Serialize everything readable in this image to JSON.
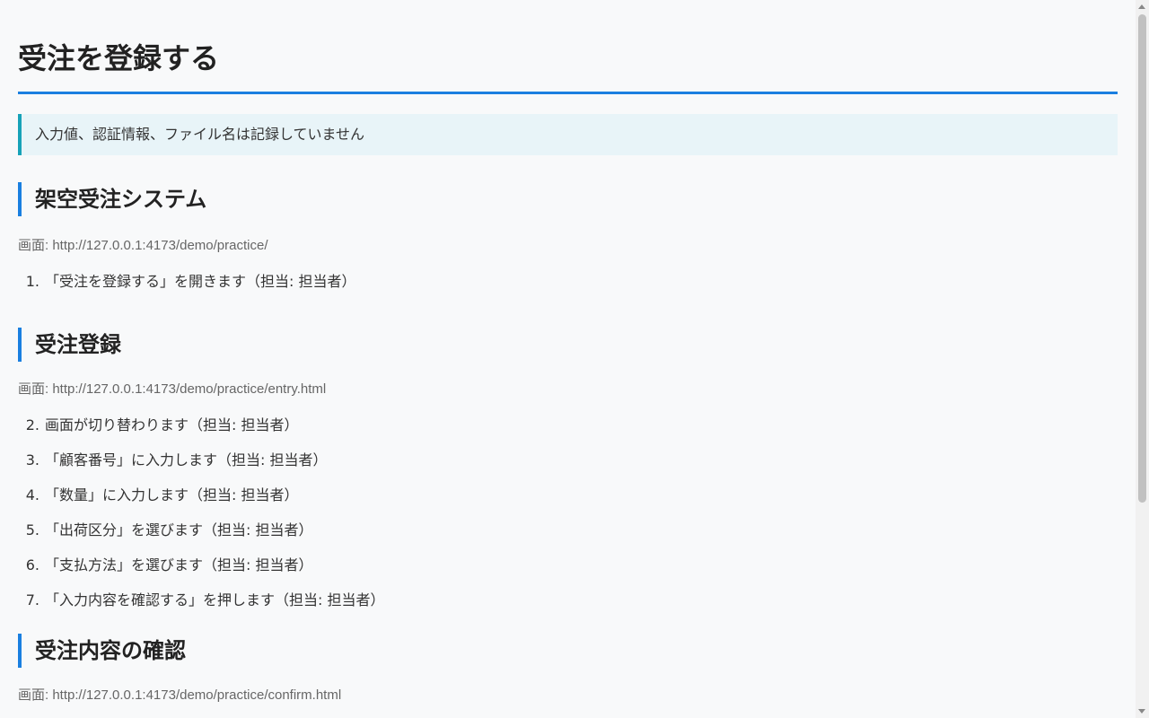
{
  "page": {
    "title": "受注を登録する",
    "notice": "入力値、認証情報、ファイル名は記録していません"
  },
  "sections": [
    {
      "heading": "架空受注システム",
      "screen": "画面: http://127.0.0.1:4173/demo/practice/",
      "steps": [
        {
          "num": "1.",
          "text": "「受注を登録する」を開きます（担当: 担当者）"
        }
      ]
    },
    {
      "heading": "受注登録",
      "screen": "画面: http://127.0.0.1:4173/demo/practice/entry.html",
      "steps": [
        {
          "num": "2.",
          "text": "画面が切り替わります（担当: 担当者）"
        },
        {
          "num": "3.",
          "text": "「顧客番号」に入力します（担当: 担当者）"
        },
        {
          "num": "4.",
          "text": "「数量」に入力します（担当: 担当者）"
        },
        {
          "num": "5.",
          "text": "「出荷区分」を選びます（担当: 担当者）"
        },
        {
          "num": "6.",
          "text": "「支払方法」を選びます（担当: 担当者）"
        },
        {
          "num": "7.",
          "text": "「入力内容を確認する」を押します（担当: 担当者）"
        }
      ]
    },
    {
      "heading": "受注内容の確認",
      "screen": "画面: http://127.0.0.1:4173/demo/practice/confirm.html",
      "steps": []
    }
  ],
  "colors": {
    "accent": "#1a7fe0",
    "notice_border": "#17a2b8",
    "notice_bg": "#e8f4f8",
    "background": "#f8f9fa"
  }
}
